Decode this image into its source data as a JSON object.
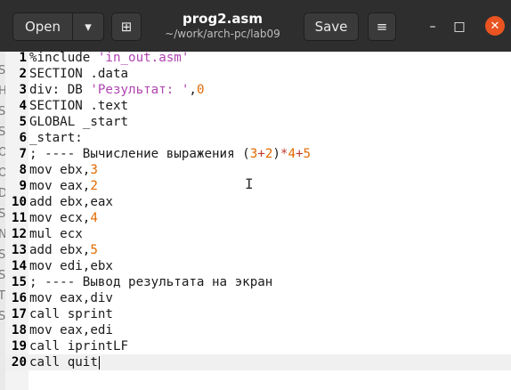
{
  "header": {
    "open_label": "Open",
    "dropdown_glyph": "▾",
    "new_tab_glyph": "⊞",
    "title": "prog2.asm",
    "subtitle": "~/work/arch-pc/lab09",
    "save_label": "Save",
    "menu_glyph": "≡",
    "minimize_glyph": "–",
    "maximize_glyph": "□",
    "close_glyph": "✕"
  },
  "left_strip": [
    "St",
    "Н",
    "S",
    "S",
    "O",
    "O",
    "D",
    "S",
    "N",
    "S",
    "S",
    "T",
    "Se"
  ],
  "lines": [
    {
      "n": "1",
      "parts": [
        {
          "t": "%include "
        },
        {
          "t": "'in_out.asm'",
          "c": "str"
        }
      ]
    },
    {
      "n": "2",
      "parts": [
        {
          "t": "SECTION .data"
        }
      ]
    },
    {
      "n": "3",
      "parts": [
        {
          "t": "div: DB "
        },
        {
          "t": "'Результат: '",
          "c": "str"
        },
        {
          "t": ","
        },
        {
          "t": "0",
          "c": "num"
        }
      ]
    },
    {
      "n": "4",
      "parts": [
        {
          "t": "SECTION .text"
        }
      ]
    },
    {
      "n": "5",
      "parts": [
        {
          "t": "GLOBAL _start"
        }
      ]
    },
    {
      "n": "6",
      "parts": [
        {
          "t": "_start:"
        }
      ]
    },
    {
      "n": "7",
      "parts": [
        {
          "t": "; ---- Вычисление выражения ("
        },
        {
          "t": "3",
          "c": "num"
        },
        {
          "t": "+",
          "c": "op"
        },
        {
          "t": "2",
          "c": "num"
        },
        {
          "t": ")"
        },
        {
          "t": "*",
          "c": "op"
        },
        {
          "t": "4",
          "c": "num"
        },
        {
          "t": "+",
          "c": "op"
        },
        {
          "t": "5",
          "c": "num"
        }
      ]
    },
    {
      "n": "8",
      "parts": [
        {
          "t": "mov ebx,"
        },
        {
          "t": "3",
          "c": "num"
        }
      ]
    },
    {
      "n": "9",
      "parts": [
        {
          "t": "mov eax,"
        },
        {
          "t": "2",
          "c": "num"
        }
      ]
    },
    {
      "n": "10",
      "parts": [
        {
          "t": "add ebx,eax"
        }
      ]
    },
    {
      "n": "11",
      "parts": [
        {
          "t": "mov ecx,"
        },
        {
          "t": "4",
          "c": "num"
        }
      ]
    },
    {
      "n": "12",
      "parts": [
        {
          "t": "mul ecx"
        }
      ]
    },
    {
      "n": "13",
      "parts": [
        {
          "t": "add ebx,"
        },
        {
          "t": "5",
          "c": "num"
        }
      ]
    },
    {
      "n": "14",
      "parts": [
        {
          "t": "mov edi,ebx"
        }
      ]
    },
    {
      "n": "15",
      "parts": [
        {
          "t": "; ---- Вывод результата на экран"
        }
      ]
    },
    {
      "n": "16",
      "parts": [
        {
          "t": "mov eax,div"
        }
      ]
    },
    {
      "n": "17",
      "parts": [
        {
          "t": "call sprint"
        }
      ]
    },
    {
      "n": "18",
      "parts": [
        {
          "t": "mov eax,edi"
        }
      ]
    },
    {
      "n": "19",
      "parts": [
        {
          "t": "call iprintLF"
        }
      ]
    },
    {
      "n": "20",
      "parts": [
        {
          "t": "call quit"
        }
      ],
      "current": true
    }
  ],
  "colors": {
    "header_bg": "#2e2e2e",
    "close_button": "#e95420",
    "string": "#b044b0",
    "number": "#e26a00",
    "operator": "#c0392b"
  }
}
